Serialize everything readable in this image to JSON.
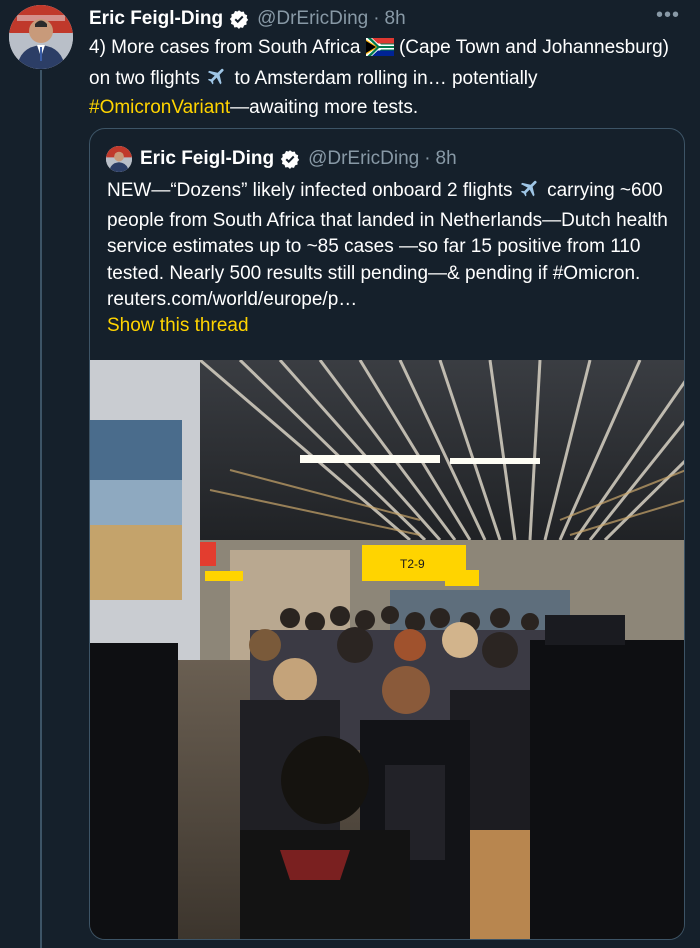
{
  "tweet": {
    "author_name": "Eric Feigl-Ding",
    "handle": "@DrEricDing",
    "separator": "·",
    "time": "8h",
    "more_label": "•••",
    "text_part1": "4) More cases from South Africa ",
    "text_part2": " (Cape Town and Johannesburg) on two flights ",
    "text_part3": " to Amsterdam rolling in… potentially ",
    "hashtag": "#OmicronVariant",
    "text_part4": "—awaiting more tests."
  },
  "quoted": {
    "author_name": "Eric Feigl-Ding",
    "handle": "@DrEricDing",
    "separator": "·",
    "time": "8h",
    "text_part1": "NEW—“Dozens” likely infected onboard 2 flights ",
    "text_part2": "  carrying ~600 people from South Africa that landed in Netherlands—Dutch health service estimates up to ~85 cases —so far 15 positive from 110 tested. Nearly 500 results still pending—& pending if #Omicron. reuters.com/world/europe/p…",
    "show_thread": "Show this thread",
    "sign_text": "T2-9"
  },
  "colors": {
    "background": "#15202b",
    "accent": "#ffd400",
    "secondary_text": "#8899a6",
    "border": "#3d5466",
    "verified": "#ffffff"
  },
  "icons": [
    "verified-badge-icon",
    "more-options-icon",
    "south-africa-flag-icon",
    "airplane-icon"
  ]
}
